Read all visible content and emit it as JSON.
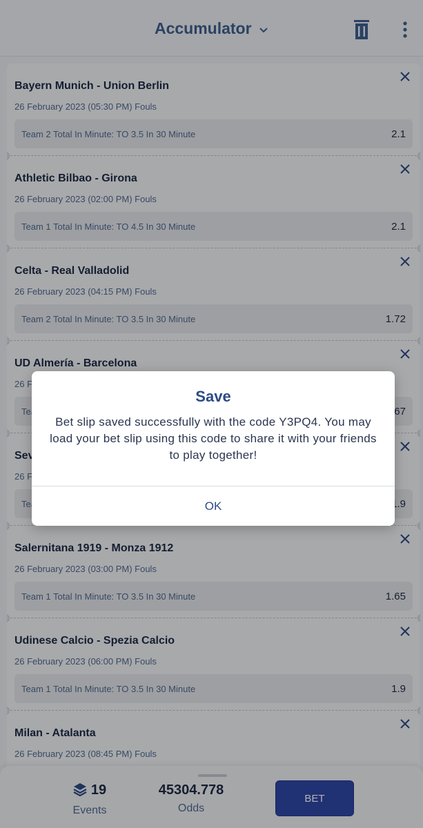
{
  "header": {
    "title": "Accumulator"
  },
  "bets": [
    {
      "match": "Bayern Munich - Union Berlin",
      "date": "26 February 2023 (05:30 PM) Fouls",
      "market": "Team 2 Total In Minute: TO 3.5 In 30 Minute",
      "odd": "2.1"
    },
    {
      "match": "Athletic Bilbao - Girona",
      "date": "26 February 2023 (02:00 PM) Fouls",
      "market": "Team 1 Total In Minute: TO 4.5 In 30 Minute",
      "odd": "2.1"
    },
    {
      "match": "Celta - Real Valladolid",
      "date": "26 February 2023 (04:15 PM) Fouls",
      "market": "Team 2 Total In Minute: TO 3.5 In 30 Minute",
      "odd": "1.72"
    },
    {
      "match": "UD Almería - Barcelona",
      "date": "26 February 2023",
      "market": "Team",
      "odd": "1.67"
    },
    {
      "match": "Sev",
      "date": "26 F",
      "market": "Tea",
      "odd": "1.9"
    },
    {
      "match": "Salernitana 1919 - Monza 1912",
      "date": "26 February 2023 (03:00 PM) Fouls",
      "market": "Team 1 Total In Minute: TO 3.5 In 30 Minute",
      "odd": "1.65"
    },
    {
      "match": "Udinese Calcio - Spezia Calcio",
      "date": "26 February 2023 (06:00 PM) Fouls",
      "market": "Team 1 Total In Minute: TO 3.5 In 30 Minute",
      "odd": "1.9"
    },
    {
      "match": "Milan - Atalanta",
      "date": "26 February 2023 (08:45 PM) Fouls",
      "market": "",
      "odd": ""
    }
  ],
  "dialog": {
    "title": "Save",
    "message": "Bet slip saved successfully with the code Y3PQ4. You may load your bet slip using this code to share it with your friends to play together!",
    "ok_label": "OK"
  },
  "footer": {
    "events_count": "19",
    "events_label": "Events",
    "odds_value": "45304.778",
    "odds_label": "Odds",
    "bet_label": "BET"
  },
  "colors": {
    "accent": "#2f47a6",
    "title": "#3d5f8f",
    "close_icon": "#2e4a86"
  },
  "icons": {
    "header": [
      "chevron-down-icon",
      "trash-icon",
      "more-vertical-icon"
    ],
    "card": "close-icon",
    "footer": "layers-icon"
  }
}
